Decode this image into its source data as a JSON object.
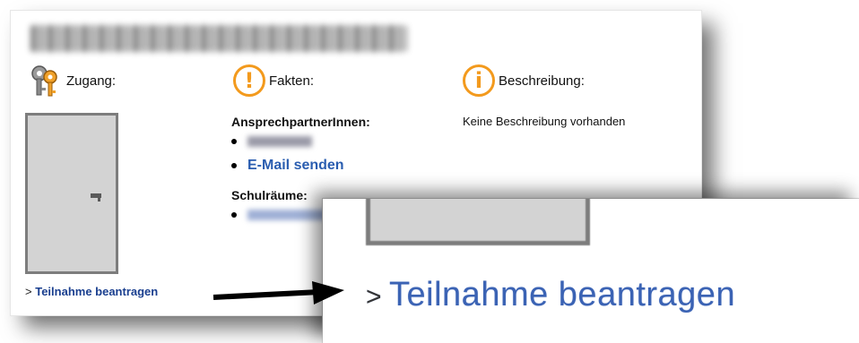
{
  "main": {
    "blurred_title": "",
    "access_label": "Zugang:",
    "facts_label": "Fakten:",
    "description_label": "Beschreibung:",
    "contacts_title": "AnsprechpartnerInnen:",
    "email_link": "E-Mail senden",
    "rooms_title": "Schulräume:",
    "description_text": "Keine Beschreibung vorhanden",
    "participation_link": "Teilnahme beantragen",
    "link_prefix": ">"
  },
  "zoom": {
    "participation_link": "Teilnahme beantragen",
    "link_prefix": ">"
  },
  "colors": {
    "link_blue": "#2a5db0",
    "info_orange": "#f39a1d",
    "door_gray": "#d3d3d3"
  },
  "icons": [
    "keys-icon",
    "exclamation-icon",
    "info-icon",
    "door-image",
    "arrow-icon"
  ]
}
